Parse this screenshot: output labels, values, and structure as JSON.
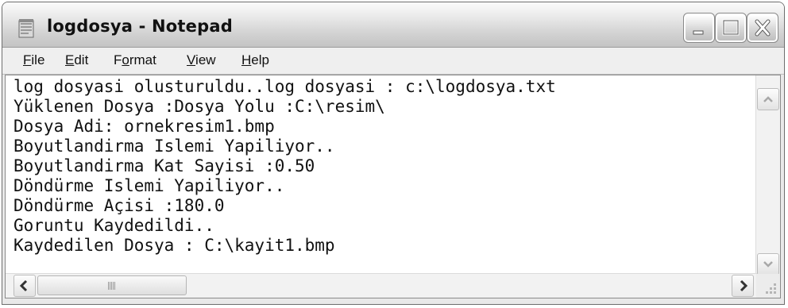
{
  "window": {
    "title": "logdosya - Notepad"
  },
  "menu": {
    "file": {
      "mnemonic": "F",
      "rest": "ile"
    },
    "edit": {
      "mnemonic": "E",
      "rest": "dit"
    },
    "format": {
      "before": "F",
      "mnemonic": "o",
      "rest": "rmat"
    },
    "view": {
      "mnemonic": "V",
      "rest": "iew"
    },
    "help": {
      "mnemonic": "H",
      "rest": "elp"
    }
  },
  "document": {
    "lines": [
      "log dosyasi olusturuldu..log dosyasi : c:\\logdosya.txt",
      "Yüklenen Dosya :Dosya Yolu :C:\\resim\\",
      "Dosya Adi: ornekresim1.bmp",
      "Boyutlandirma Islemi Yapiliyor..",
      "Boyutlandirma Kat Sayisi :0.50",
      "Döndürme Islemi Yapiliyor..",
      "Döndürme Açisi :180.0",
      "Goruntu Kaydedildi..",
      "Kaydedilen Dosya : C:\\kayit1.bmp"
    ]
  },
  "icons": {
    "app": "notepad-icon",
    "minimize": "minimize-icon",
    "maximize": "maximize-icon",
    "close": "close-icon"
  }
}
